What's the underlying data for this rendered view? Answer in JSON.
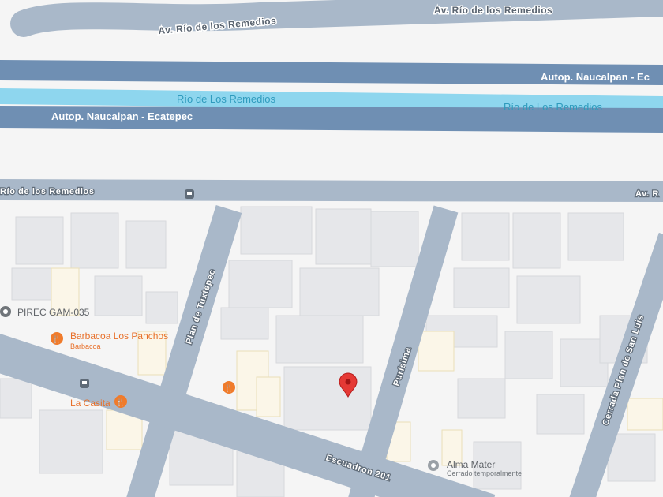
{
  "streets": {
    "av_rio_top_1": "Av. Río de los Remedios",
    "av_rio_top_2": "Av. Río de los Remedios",
    "autopista_1": "Autop. Naucalpan - Ec",
    "autopista_2": "Autop. Naucalpan - Ecatepec",
    "river_1": "Río de Los Remedios",
    "river_2": "Río de Los Remedios",
    "av_rio_low_left": "Río de los Remedios",
    "av_rio_low_right": "Av. R",
    "plan_tuxtepec": "Plan de Tuxtepec",
    "purisima": "Purísima",
    "cerrada": "Cerrada Plan de San Luis",
    "escuadron": "Escuadron 201"
  },
  "pois": [
    {
      "name": "PIREC GAM-035",
      "icon": "place-pin-icon"
    },
    {
      "name": "Barbacoa Los Panchos",
      "sub": "Barbacoa",
      "icon": "restaurant-icon"
    },
    {
      "name": "La Casita",
      "icon": "restaurant-icon"
    },
    {
      "name": "Alma Mater",
      "sub": "Cerrado temporalmente",
      "icon": "place-pin-icon"
    }
  ],
  "colors": {
    "highway": "#6f8fb3",
    "arterial": "#a9b8c9",
    "river": "#8ed6ee",
    "marker": "#e53935",
    "poi_food": "#f07b2b"
  }
}
